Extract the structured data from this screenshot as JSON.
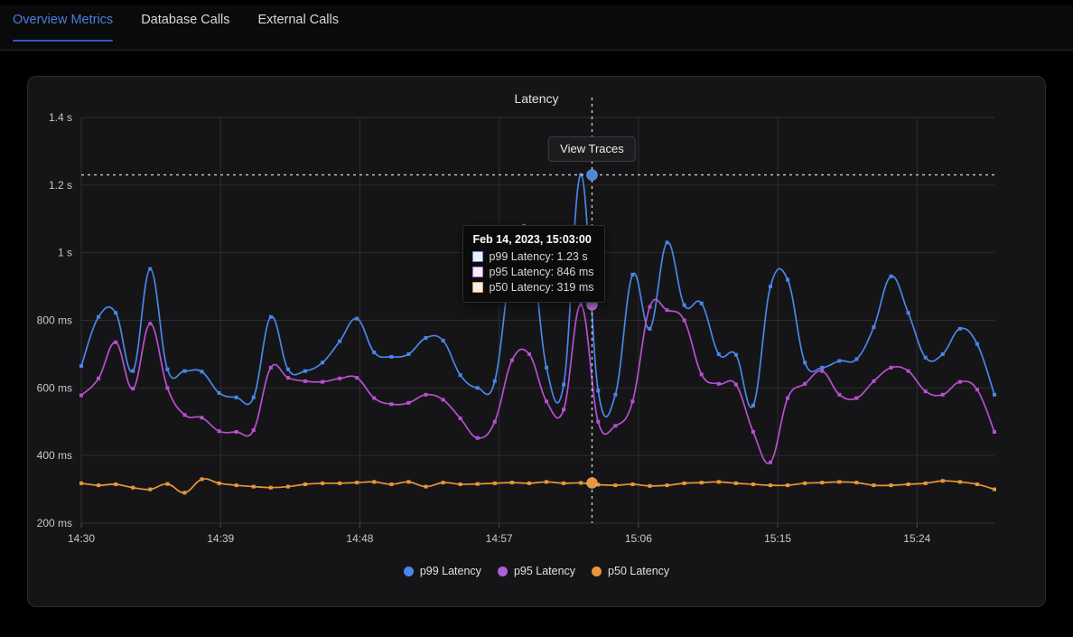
{
  "tabs": [
    {
      "label": "Overview Metrics",
      "active": true
    },
    {
      "label": "Database Calls",
      "active": false
    },
    {
      "label": "External Calls",
      "active": false
    }
  ],
  "card": {
    "title": "Latency"
  },
  "overlay": {
    "view_traces_label": "View Traces"
  },
  "tooltip": {
    "title": "Feb 14, 2023, 15:03:00",
    "rows": [
      {
        "label": "p99 Latency: 1.23 s",
        "color": "#5b8ff9"
      },
      {
        "label": "p95 Latency: 846 ms",
        "color": "#b06fd4"
      },
      {
        "label": "p50 Latency: 319 ms",
        "color": "#e8963c"
      }
    ]
  },
  "legend": [
    {
      "label": "p99 Latency",
      "color": "#4a86e8"
    },
    {
      "label": "p95 Latency",
      "color": "#b05ed8"
    },
    {
      "label": "p50 Latency",
      "color": "#e8963c"
    }
  ],
  "colors": {
    "accent": "#2f59b8",
    "accent_text": "#4a7fe0",
    "p99": "#4a86e8",
    "p95": "#b84fd0",
    "p50": "#e8963c",
    "grid": "#2e2e31",
    "card_bg": "#151517",
    "page_bg": "#000000"
  },
  "chart_data": {
    "type": "line",
    "title": "Latency",
    "xlabel": "",
    "ylabel": "",
    "grid": true,
    "legend_position": "bottom",
    "ylim": [
      200,
      1400
    ],
    "yunit": "ms",
    "ytick_labels": [
      "200 ms",
      "400 ms",
      "600 ms",
      "800 ms",
      "1 s",
      "1.2 s",
      "1.4 s"
    ],
    "ytick_values": [
      200,
      400,
      600,
      800,
      1000,
      1200,
      1400
    ],
    "xlim": [
      "14:30",
      "15:29"
    ],
    "xtick_labels": [
      "14:30",
      "14:39",
      "14:48",
      "14:57",
      "15:06",
      "15:15",
      "15:24"
    ],
    "xtick_values": [
      0,
      9,
      18,
      27,
      36,
      45,
      54
    ],
    "x_minutes_total": 59,
    "cursor": {
      "x_minute": 33,
      "time_label": "15:03:00",
      "p99": 1230,
      "p95": 846,
      "p50": 319,
      "hline_value": 1230
    },
    "series": [
      {
        "name": "p99 Latency",
        "color": "#4a86e8",
        "values": [
          665,
          810,
          822,
          650,
          952,
          655,
          650,
          648,
          585,
          572,
          572,
          810,
          655,
          650,
          675,
          738,
          805,
          705,
          692,
          700,
          748,
          740,
          638,
          600,
          620,
          980,
          1057,
          660,
          610,
          1230,
          592,
          580,
          935,
          775,
          1030,
          845,
          850,
          700,
          698,
          548,
          900,
          920,
          675,
          660,
          680,
          685,
          780,
          930,
          822,
          690,
          700,
          775,
          730,
          580
        ]
      },
      {
        "name": "p95 Latency",
        "color": "#b84fd0",
        "values": [
          578,
          628,
          735,
          598,
          790,
          600,
          520,
          512,
          472,
          470,
          475,
          660,
          630,
          620,
          618,
          628,
          630,
          570,
          552,
          556,
          580,
          565,
          510,
          452,
          500,
          682,
          700,
          560,
          536,
          846,
          500,
          488,
          560,
          840,
          830,
          800,
          640,
          612,
          610,
          470,
          380,
          570,
          612,
          650,
          580,
          570,
          620,
          660,
          650,
          590,
          580,
          618,
          595,
          470
        ]
      },
      {
        "name": "p50 Latency",
        "color": "#e8963c",
        "values": [
          318,
          312,
          315,
          305,
          300,
          316,
          290,
          330,
          318,
          312,
          308,
          305,
          308,
          315,
          318,
          318,
          320,
          322,
          315,
          322,
          308,
          320,
          315,
          316,
          318,
          320,
          318,
          322,
          318,
          319,
          314,
          312,
          315,
          310,
          312,
          318,
          320,
          322,
          318,
          315,
          312,
          312,
          318,
          320,
          322,
          320,
          312,
          312,
          315,
          318,
          325,
          322,
          315,
          300
        ]
      }
    ]
  }
}
